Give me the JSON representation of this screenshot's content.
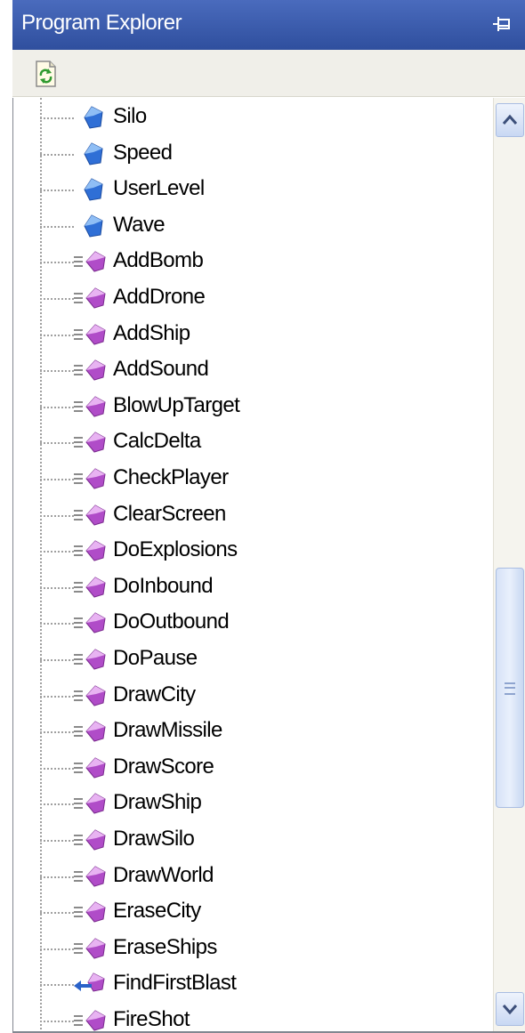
{
  "panel": {
    "title": "Program Explorer"
  },
  "toolbar": {
    "refresh_icon": "refresh-icon"
  },
  "tree": {
    "items": [
      {
        "label": "Silo",
        "kind": "property"
      },
      {
        "label": "Speed",
        "kind": "property"
      },
      {
        "label": "UserLevel",
        "kind": "property"
      },
      {
        "label": "Wave",
        "kind": "property"
      },
      {
        "label": "AddBomb",
        "kind": "method"
      },
      {
        "label": "AddDrone",
        "kind": "method"
      },
      {
        "label": "AddShip",
        "kind": "method"
      },
      {
        "label": "AddSound",
        "kind": "method"
      },
      {
        "label": "BlowUpTarget",
        "kind": "method"
      },
      {
        "label": "CalcDelta",
        "kind": "method"
      },
      {
        "label": "CheckPlayer",
        "kind": "method"
      },
      {
        "label": "ClearScreen",
        "kind": "method"
      },
      {
        "label": "DoExplosions",
        "kind": "method"
      },
      {
        "label": "DoInbound",
        "kind": "method"
      },
      {
        "label": "DoOutbound",
        "kind": "method"
      },
      {
        "label": "DoPause",
        "kind": "method"
      },
      {
        "label": "DrawCity",
        "kind": "method"
      },
      {
        "label": "DrawMissile",
        "kind": "method"
      },
      {
        "label": "DrawScore",
        "kind": "method"
      },
      {
        "label": "DrawShip",
        "kind": "method"
      },
      {
        "label": "DrawSilo",
        "kind": "method"
      },
      {
        "label": "DrawWorld",
        "kind": "method"
      },
      {
        "label": "EraseCity",
        "kind": "method"
      },
      {
        "label": "EraseShips",
        "kind": "method"
      },
      {
        "label": "FindFirstBlast",
        "kind": "function"
      },
      {
        "label": "FireShot",
        "kind": "method"
      }
    ]
  },
  "colors": {
    "title_bar": "#3b5aa8",
    "property_icon": "#2f6fd6",
    "method_icon": "#b04cc8",
    "function_icon": "#2a62c9"
  }
}
